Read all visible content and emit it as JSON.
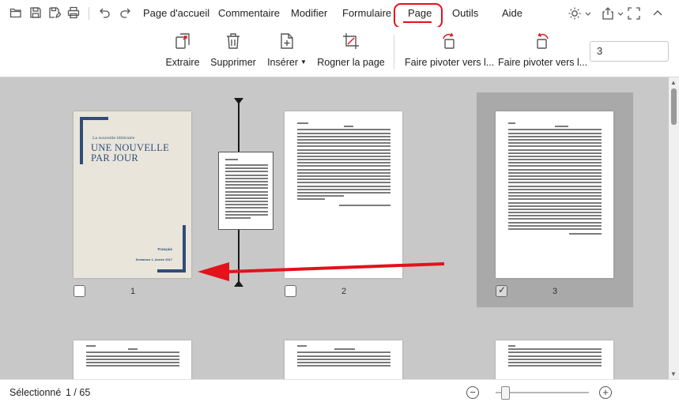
{
  "quick_access": {
    "icons": [
      "folder-open-icon",
      "save-icon",
      "save-as-icon",
      "print-icon",
      "undo-icon",
      "redo-icon"
    ]
  },
  "menu": {
    "items": [
      "Page d'accueil",
      "Commentaire",
      "Modifier",
      "Formulaire",
      "Page",
      "Outils",
      "Aide"
    ],
    "active": "Page",
    "highlight_color": "#e3121b"
  },
  "toolbar": {
    "tools": [
      {
        "label": "Extraire",
        "icon": "extract-icon"
      },
      {
        "label": "Supprimer",
        "icon": "trash-icon"
      },
      {
        "label": "Insérer",
        "icon": "insert-page-icon",
        "has_dropdown": true
      },
      {
        "label": "Rogner la page",
        "icon": "crop-icon"
      },
      {
        "label": "Faire pivoter vers l...",
        "icon": "rotate-left-icon"
      },
      {
        "label": "Faire pivoter vers l...",
        "icon": "rotate-right-icon"
      }
    ],
    "page_input_value": "3"
  },
  "pages": [
    {
      "number": "1",
      "checked": false,
      "cover": {
        "kicker": "La nouvelle littéraire",
        "title": "UNE NOUVELLE PAR JOUR",
        "line1": "Français",
        "line2": "Semaines 1, Année 2017"
      }
    },
    {
      "number": "2",
      "checked": false
    },
    {
      "number": "3",
      "checked": true
    }
  ],
  "status": {
    "label": "Sélectionné",
    "count": "1 / 65"
  },
  "zoom": {
    "level_fraction": 0.1
  },
  "colors": {
    "accent": "#e3121b",
    "cover_blue": "#2f4d77",
    "canvas_bg": "#c8c8c8"
  }
}
